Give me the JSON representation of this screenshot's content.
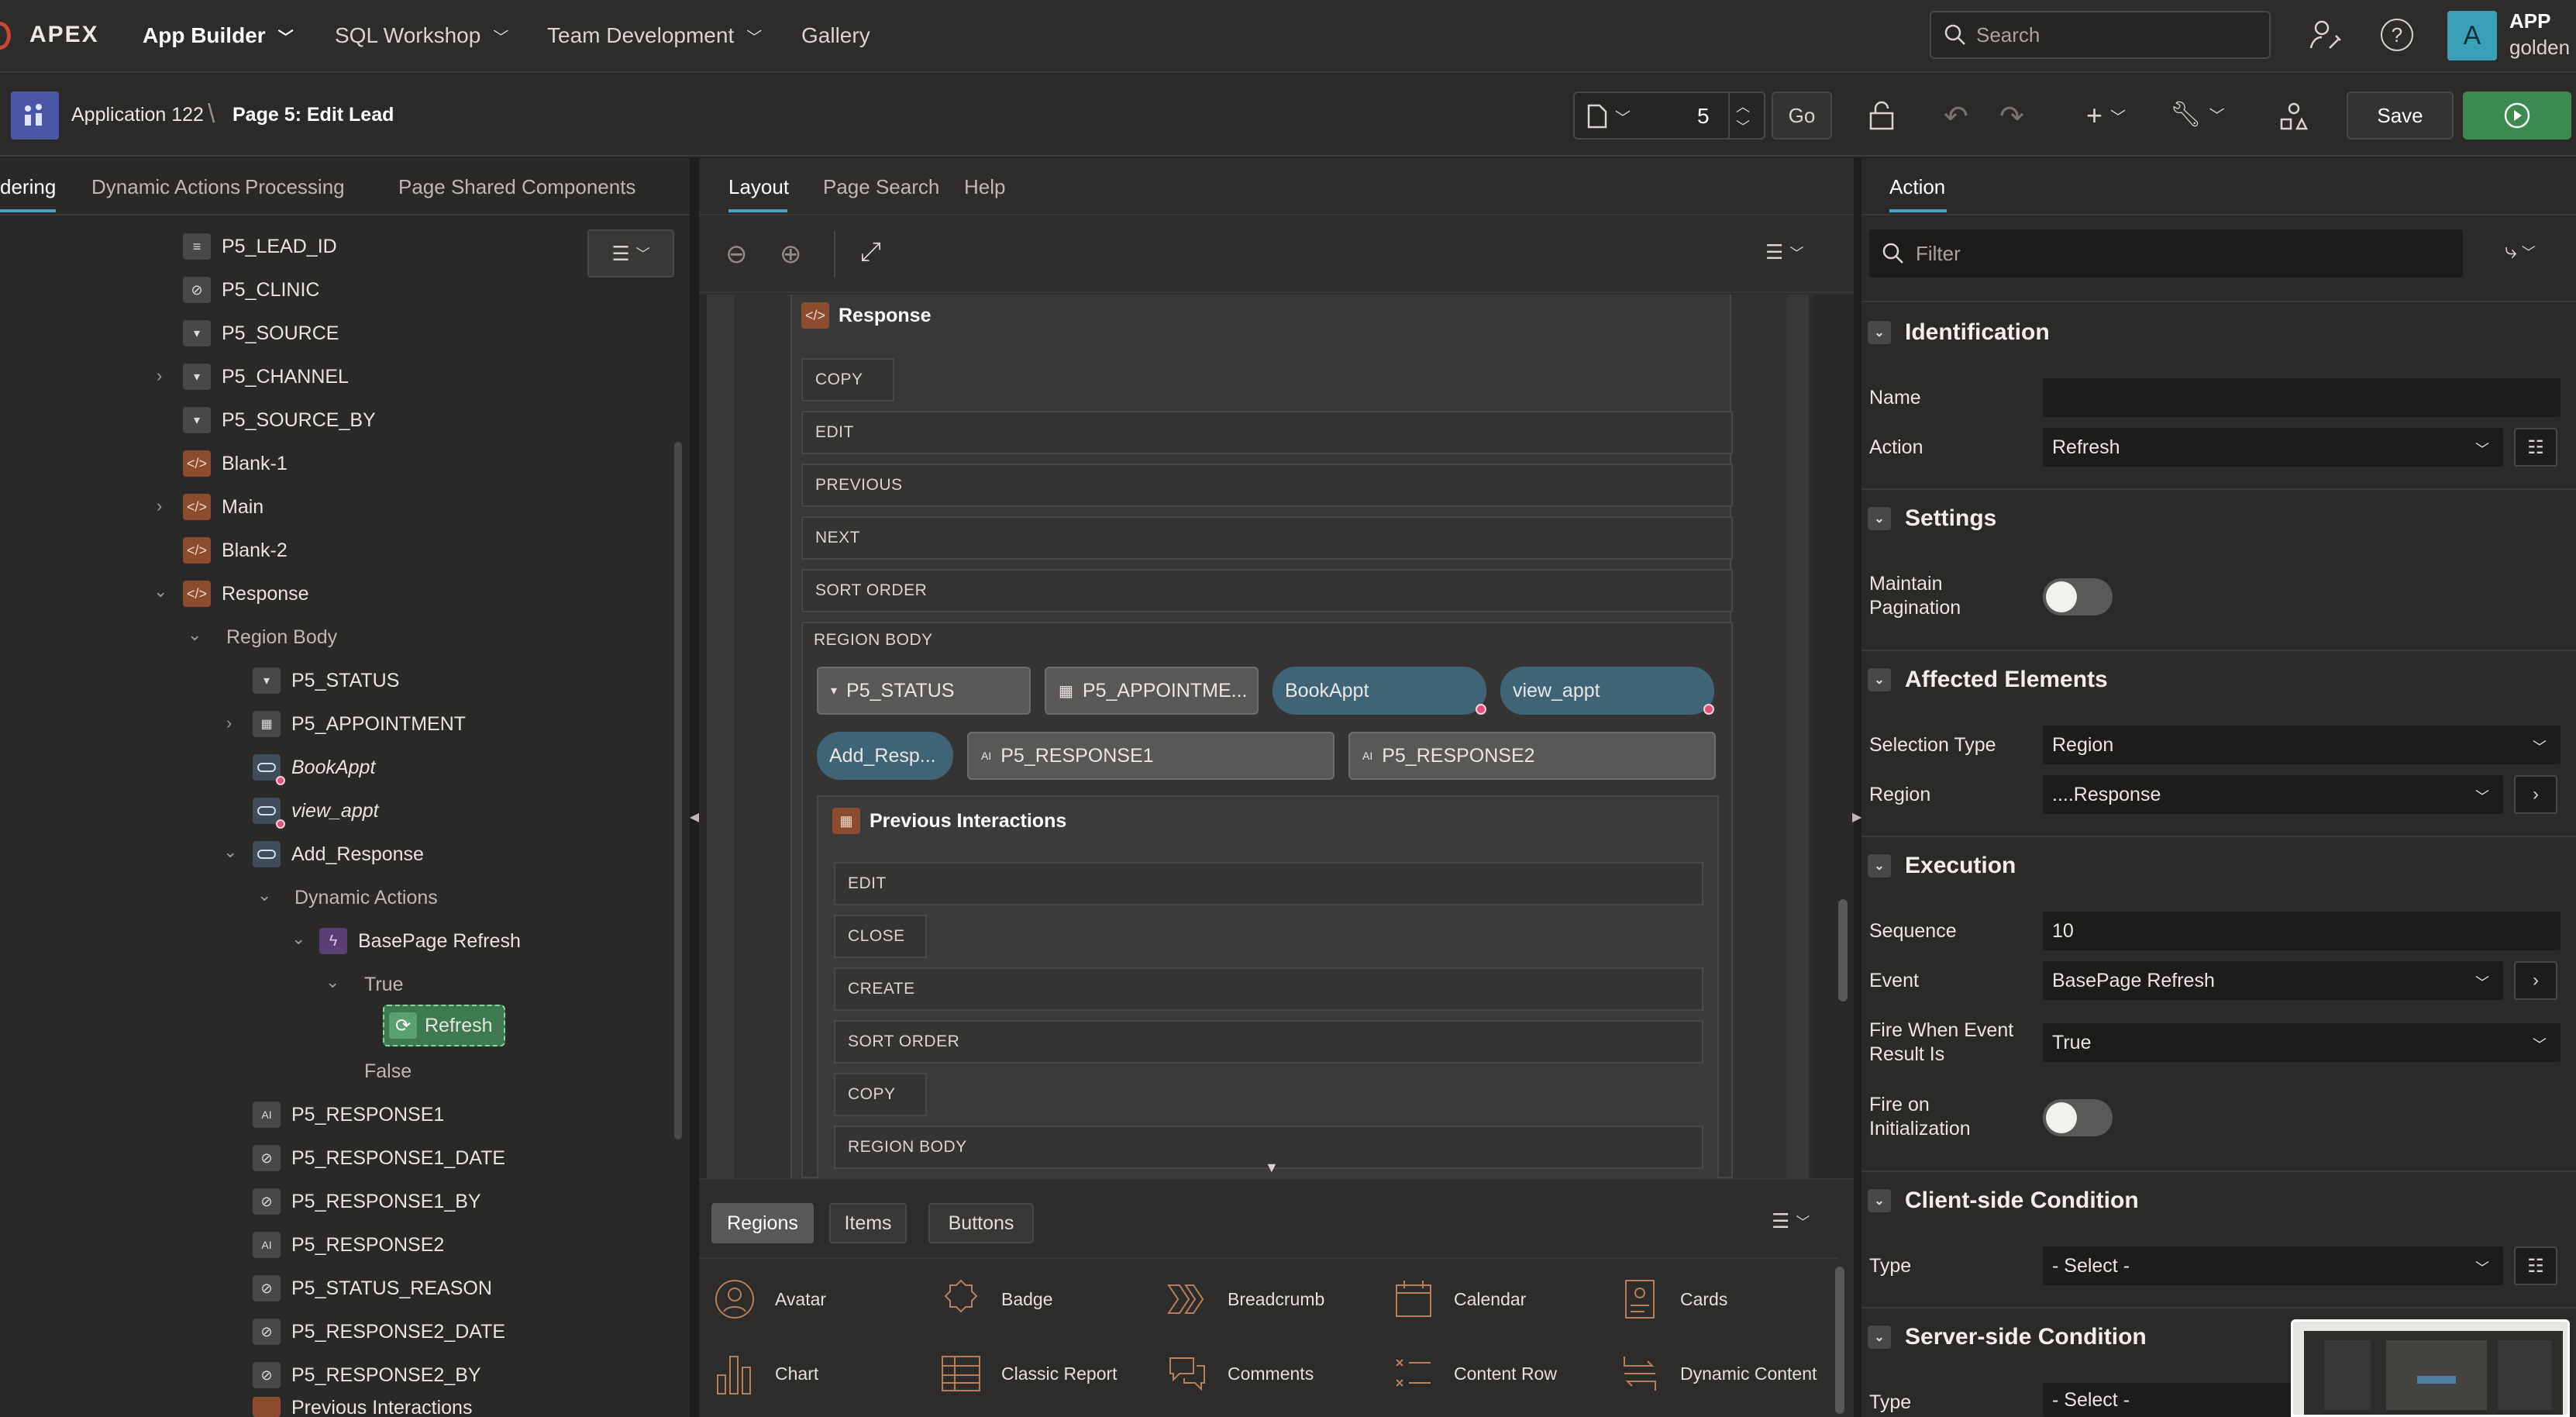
{
  "nav": {
    "brand": "APEX",
    "items": [
      "App Builder",
      "SQL Workshop",
      "Team Development",
      "Gallery"
    ],
    "search_placeholder": "Search",
    "user": {
      "initial": "A",
      "name": "APP",
      "workspace": "golden"
    }
  },
  "toolbar": {
    "application": "Application 122",
    "page": "Page 5: Edit Lead",
    "page_number": "5",
    "go_label": "Go",
    "save_label": "Save"
  },
  "left": {
    "tabs": [
      "dering",
      "Dynamic Actions",
      "Processing",
      "Page Shared Components"
    ],
    "tree": [
      {
        "label": "P5_LEAD_ID"
      },
      {
        "label": "P5_CLINIC"
      },
      {
        "label": "P5_SOURCE"
      },
      {
        "label": "P5_CHANNEL"
      },
      {
        "label": "P5_SOURCE_BY"
      },
      {
        "label": "Blank-1"
      },
      {
        "label": "Main"
      },
      {
        "label": "Blank-2"
      },
      {
        "label": "Response"
      },
      {
        "label": "Region Body"
      },
      {
        "label": "P5_STATUS"
      },
      {
        "label": "P5_APPOINTMENT"
      },
      {
        "label": "BookAppt"
      },
      {
        "label": "view_appt"
      },
      {
        "label": "Add_Response"
      },
      {
        "label": "Dynamic Actions"
      },
      {
        "label": "BasePage Refresh"
      },
      {
        "label": "True"
      },
      {
        "label": "Refresh"
      },
      {
        "label": "False"
      },
      {
        "label": "P5_RESPONSE1"
      },
      {
        "label": "P5_RESPONSE1_DATE"
      },
      {
        "label": "P5_RESPONSE1_BY"
      },
      {
        "label": "P5_RESPONSE2"
      },
      {
        "label": "P5_STATUS_REASON"
      },
      {
        "label": "P5_RESPONSE2_DATE"
      },
      {
        "label": "P5_RESPONSE2_BY"
      },
      {
        "label": "Previous Interactions"
      }
    ]
  },
  "middle": {
    "tabs": [
      "Layout",
      "Page Search",
      "Help"
    ],
    "region_title": "Response",
    "bars": [
      "COPY",
      "EDIT",
      "PREVIOUS",
      "NEXT",
      "SORT ORDER",
      "REGION BODY"
    ],
    "chips": [
      "P5_STATUS",
      "P5_APPOINTME...",
      "BookAppt",
      "view_appt",
      "Add_Resp...",
      "P5_RESPONSE1",
      "P5_RESPONSE2"
    ],
    "sub_region_title": "Previous Interactions",
    "sub_bars": [
      "EDIT",
      "CLOSE",
      "CREATE",
      "SORT ORDER",
      "COPY",
      "REGION BODY"
    ],
    "gallery_tabs": [
      "Regions",
      "Items",
      "Buttons"
    ],
    "gallery": [
      "Avatar",
      "Badge",
      "Breadcrumb",
      "Calendar",
      "Cards",
      "Chart",
      "Classic Report",
      "Comments",
      "Content Row",
      "Dynamic Content"
    ]
  },
  "right": {
    "tab": "Action",
    "filter_placeholder": "Filter",
    "sections": {
      "identification": "Identification",
      "settings": "Settings",
      "affected": "Affected Elements",
      "execution": "Execution",
      "client": "Client-side Condition",
      "server": "Server-side Condition"
    },
    "labels": {
      "name": "Name",
      "action": "Action",
      "maintain_pagination": "Maintain Pagination",
      "selection_type": "Selection Type",
      "region": "Region",
      "sequence": "Sequence",
      "event": "Event",
      "fire_when": "Fire When Event Result Is",
      "fire_on_init": "Fire on Initialization",
      "type": "Type",
      "type2": "Type"
    },
    "values": {
      "name": "",
      "action": "Refresh",
      "selection_type": "Region",
      "region": "....Response",
      "sequence": "10",
      "event": "BasePage Refresh",
      "fire_when": "True",
      "client_type": "- Select -",
      "server_type": "- Select -"
    }
  },
  "colors": {
    "accent": "#4aa0c8",
    "save_green": "#3c8a4f",
    "selected_node": "#3d7a4f"
  }
}
